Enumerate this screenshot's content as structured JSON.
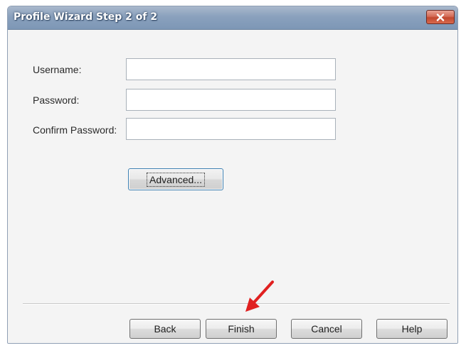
{
  "window": {
    "title": "Profile Wizard Step 2 of 2",
    "close_icon": "close-icon"
  },
  "form": {
    "username_label": "Username:",
    "username_value": "",
    "password_label": "Password:",
    "password_value": "",
    "confirm_label": "Confirm Password:",
    "confirm_value": ""
  },
  "buttons": {
    "advanced": "Advanced...",
    "back": "Back",
    "finish": "Finish",
    "cancel": "Cancel",
    "help": "Help"
  },
  "annotation": {
    "icon": "red-arrow-icon",
    "color": "#e02020"
  }
}
